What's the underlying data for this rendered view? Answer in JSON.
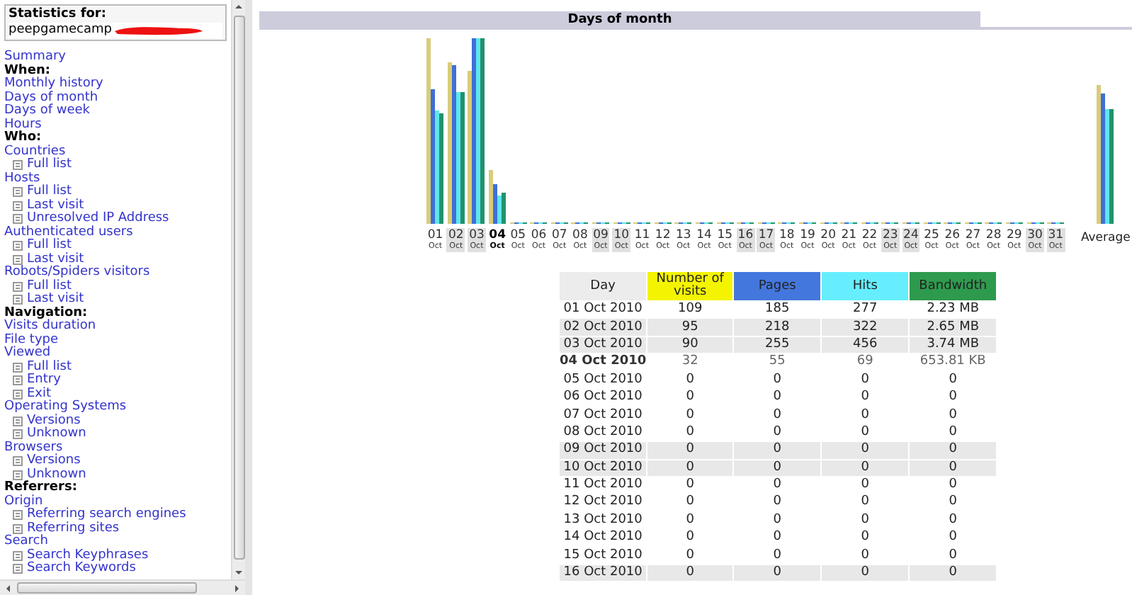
{
  "header": {
    "label": "Statistics for:",
    "site": "peepgamecamp"
  },
  "menu": [
    {
      "kind": "link",
      "label": "Summary"
    },
    {
      "kind": "heading",
      "label": "When:"
    },
    {
      "kind": "link",
      "label": "Monthly history"
    },
    {
      "kind": "link",
      "label": "Days of month"
    },
    {
      "kind": "link",
      "label": "Days of week"
    },
    {
      "kind": "link",
      "label": "Hours"
    },
    {
      "kind": "heading",
      "label": "Who:"
    },
    {
      "kind": "link",
      "label": "Countries",
      "children": [
        {
          "label": "Full list"
        }
      ]
    },
    {
      "kind": "link",
      "label": "Hosts",
      "children": [
        {
          "label": "Full list"
        },
        {
          "label": "Last visit"
        },
        {
          "label": "Unresolved IP Address"
        }
      ]
    },
    {
      "kind": "link",
      "label": "Authenticated users",
      "children": [
        {
          "label": "Full list"
        },
        {
          "label": "Last visit"
        }
      ]
    },
    {
      "kind": "link",
      "label": "Robots/Spiders visitors",
      "children": [
        {
          "label": "Full list"
        },
        {
          "label": "Last visit"
        }
      ]
    },
    {
      "kind": "heading",
      "label": "Navigation:"
    },
    {
      "kind": "link",
      "label": "Visits duration"
    },
    {
      "kind": "link",
      "label": "File type"
    },
    {
      "kind": "link",
      "label": "Viewed",
      "children": [
        {
          "label": "Full list"
        },
        {
          "label": "Entry"
        },
        {
          "label": "Exit"
        }
      ]
    },
    {
      "kind": "link",
      "label": "Operating Systems",
      "children": [
        {
          "label": "Versions"
        },
        {
          "label": "Unknown"
        }
      ]
    },
    {
      "kind": "link",
      "label": "Browsers",
      "children": [
        {
          "label": "Versions"
        },
        {
          "label": "Unknown"
        }
      ]
    },
    {
      "kind": "heading",
      "label": "Referrers:"
    },
    {
      "kind": "link",
      "label": "Origin",
      "children": [
        {
          "label": "Referring search engines"
        },
        {
          "label": "Referring sites"
        }
      ]
    },
    {
      "kind": "link",
      "label": "Search",
      "children": [
        {
          "label": "Search Keyphrases"
        },
        {
          "label": "Search Keywords"
        }
      ]
    }
  ],
  "section": {
    "title": "Days of month"
  },
  "chart": {
    "days": [
      {
        "day": "01",
        "month": "Oct",
        "weekend": false,
        "today": false
      },
      {
        "day": "02",
        "month": "Oct",
        "weekend": true,
        "today": false
      },
      {
        "day": "03",
        "month": "Oct",
        "weekend": true,
        "today": false
      },
      {
        "day": "04",
        "month": "Oct",
        "weekend": false,
        "today": true
      },
      {
        "day": "05",
        "month": "Oct",
        "weekend": false,
        "today": false
      },
      {
        "day": "06",
        "month": "Oct",
        "weekend": false,
        "today": false
      },
      {
        "day": "07",
        "month": "Oct",
        "weekend": false,
        "today": false
      },
      {
        "day": "08",
        "month": "Oct",
        "weekend": false,
        "today": false
      },
      {
        "day": "09",
        "month": "Oct",
        "weekend": true,
        "today": false
      },
      {
        "day": "10",
        "month": "Oct",
        "weekend": true,
        "today": false
      },
      {
        "day": "11",
        "month": "Oct",
        "weekend": false,
        "today": false
      },
      {
        "day": "12",
        "month": "Oct",
        "weekend": false,
        "today": false
      },
      {
        "day": "13",
        "month": "Oct",
        "weekend": false,
        "today": false
      },
      {
        "day": "14",
        "month": "Oct",
        "weekend": false,
        "today": false
      },
      {
        "day": "15",
        "month": "Oct",
        "weekend": false,
        "today": false
      },
      {
        "day": "16",
        "month": "Oct",
        "weekend": true,
        "today": false
      },
      {
        "day": "17",
        "month": "Oct",
        "weekend": true,
        "today": false
      },
      {
        "day": "18",
        "month": "Oct",
        "weekend": false,
        "today": false
      },
      {
        "day": "19",
        "month": "Oct",
        "weekend": false,
        "today": false
      },
      {
        "day": "20",
        "month": "Oct",
        "weekend": false,
        "today": false
      },
      {
        "day": "21",
        "month": "Oct",
        "weekend": false,
        "today": false
      },
      {
        "day": "22",
        "month": "Oct",
        "weekend": false,
        "today": false
      },
      {
        "day": "23",
        "month": "Oct",
        "weekend": true,
        "today": false
      },
      {
        "day": "24",
        "month": "Oct",
        "weekend": true,
        "today": false
      },
      {
        "day": "25",
        "month": "Oct",
        "weekend": false,
        "today": false
      },
      {
        "day": "26",
        "month": "Oct",
        "weekend": false,
        "today": false
      },
      {
        "day": "27",
        "month": "Oct",
        "weekend": false,
        "today": false
      },
      {
        "day": "28",
        "month": "Oct",
        "weekend": false,
        "today": false
      },
      {
        "day": "29",
        "month": "Oct",
        "weekend": false,
        "today": false
      },
      {
        "day": "30",
        "month": "Oct",
        "weekend": true,
        "today": false
      },
      {
        "day": "31",
        "month": "Oct",
        "weekend": true,
        "today": false
      }
    ],
    "average_label": "Average"
  },
  "table": {
    "columns": [
      "Day",
      "Number of visits",
      "Pages",
      "Hits",
      "Bandwidth"
    ],
    "rows": [
      {
        "day": "01 Oct 2010",
        "visits": "109",
        "pages": "185",
        "hits": "277",
        "bandwidth": "2.23 MB",
        "weekend": false,
        "today": false
      },
      {
        "day": "02 Oct 2010",
        "visits": "95",
        "pages": "218",
        "hits": "322",
        "bandwidth": "2.65 MB",
        "weekend": true,
        "today": false
      },
      {
        "day": "03 Oct 2010",
        "visits": "90",
        "pages": "255",
        "hits": "456",
        "bandwidth": "3.74 MB",
        "weekend": true,
        "today": false
      },
      {
        "day": "04 Oct 2010",
        "visits": "32",
        "pages": "55",
        "hits": "69",
        "bandwidth": "653.81 KB",
        "weekend": false,
        "today": true
      },
      {
        "day": "05 Oct 2010",
        "visits": "0",
        "pages": "0",
        "hits": "0",
        "bandwidth": "0",
        "weekend": false,
        "today": false
      },
      {
        "day": "06 Oct 2010",
        "visits": "0",
        "pages": "0",
        "hits": "0",
        "bandwidth": "0",
        "weekend": false,
        "today": false
      },
      {
        "day": "07 Oct 2010",
        "visits": "0",
        "pages": "0",
        "hits": "0",
        "bandwidth": "0",
        "weekend": false,
        "today": false
      },
      {
        "day": "08 Oct 2010",
        "visits": "0",
        "pages": "0",
        "hits": "0",
        "bandwidth": "0",
        "weekend": false,
        "today": false
      },
      {
        "day": "09 Oct 2010",
        "visits": "0",
        "pages": "0",
        "hits": "0",
        "bandwidth": "0",
        "weekend": true,
        "today": false
      },
      {
        "day": "10 Oct 2010",
        "visits": "0",
        "pages": "0",
        "hits": "0",
        "bandwidth": "0",
        "weekend": true,
        "today": false
      },
      {
        "day": "11 Oct 2010",
        "visits": "0",
        "pages": "0",
        "hits": "0",
        "bandwidth": "0",
        "weekend": false,
        "today": false
      },
      {
        "day": "12 Oct 2010",
        "visits": "0",
        "pages": "0",
        "hits": "0",
        "bandwidth": "0",
        "weekend": false,
        "today": false
      },
      {
        "day": "13 Oct 2010",
        "visits": "0",
        "pages": "0",
        "hits": "0",
        "bandwidth": "0",
        "weekend": false,
        "today": false
      },
      {
        "day": "14 Oct 2010",
        "visits": "0",
        "pages": "0",
        "hits": "0",
        "bandwidth": "0",
        "weekend": false,
        "today": false
      },
      {
        "day": "15 Oct 2010",
        "visits": "0",
        "pages": "0",
        "hits": "0",
        "bandwidth": "0",
        "weekend": false,
        "today": false
      },
      {
        "day": "16 Oct 2010",
        "visits": "0",
        "pages": "0",
        "hits": "0",
        "bandwidth": "0",
        "weekend": true,
        "today": false
      }
    ]
  }
}
